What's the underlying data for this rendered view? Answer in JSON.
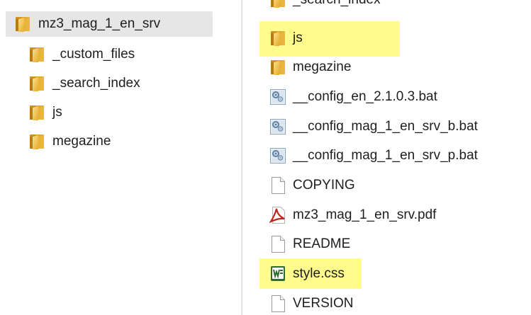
{
  "tree": {
    "root": {
      "label": "mz3_mag_1_en_srv",
      "icon": "folder-icon"
    },
    "children": [
      {
        "label": "_custom_files",
        "icon": "folder-icon"
      },
      {
        "label": "_search_index",
        "icon": "folder-icon"
      },
      {
        "label": "js",
        "icon": "folder-icon"
      },
      {
        "label": "megazine",
        "icon": "folder-icon"
      }
    ]
  },
  "files": {
    "partial_top": {
      "label": "_search_index",
      "icon": "folder-icon"
    },
    "items": [
      {
        "label": "js",
        "icon": "folder-icon",
        "highlighted": true
      },
      {
        "label": "megazine",
        "icon": "folder-icon",
        "highlighted": false
      },
      {
        "label": "__config_en_2.1.0.3.bat",
        "icon": "batch-file-icon",
        "highlighted": false
      },
      {
        "label": "__config_mag_1_en_srv_b.bat",
        "icon": "batch-file-icon",
        "highlighted": false
      },
      {
        "label": "__config_mag_1_en_srv_p.bat",
        "icon": "batch-file-icon",
        "highlighted": false
      },
      {
        "label": "COPYING",
        "icon": "blank-file-icon",
        "highlighted": false
      },
      {
        "label": "mz3_mag_1_en_srv.pdf",
        "icon": "pdf-file-icon",
        "highlighted": false
      },
      {
        "label": "README",
        "icon": "blank-file-icon",
        "highlighted": false
      },
      {
        "label": "style.css",
        "icon": "word-document-icon",
        "highlighted": true
      },
      {
        "label": "VERSION",
        "icon": "blank-file-icon",
        "highlighted": false
      }
    ]
  },
  "colors": {
    "highlight": "#fffb8c",
    "selection": "#e6e6e6",
    "folder": "#e8b93a"
  }
}
